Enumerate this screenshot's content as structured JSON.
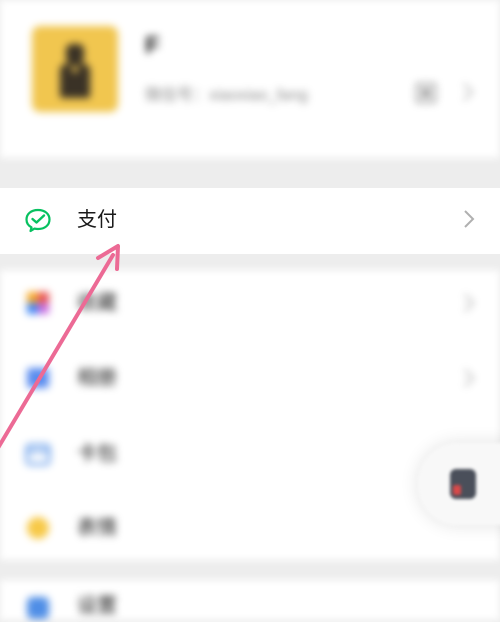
{
  "profile": {
    "name": "F",
    "wechat_id": "微信号：xiaoxiao_fang"
  },
  "pay": {
    "label": "支付",
    "icon": "wechat-pay-icon"
  },
  "list": {
    "items": [
      {
        "label": "收藏",
        "icon": "favorites-icon"
      },
      {
        "label": "相册",
        "icon": "album-icon"
      },
      {
        "label": "卡包",
        "icon": "card-wallet-icon"
      },
      {
        "label": "表情",
        "icon": "sticker-icon"
      }
    ]
  },
  "settings": {
    "label": "设置",
    "icon": "settings-icon"
  },
  "colors": {
    "pay_green": "#07c160",
    "arrow_pink": "#ec6a95",
    "background": "#ededed",
    "avatar_yellow": "#f1c64f"
  }
}
